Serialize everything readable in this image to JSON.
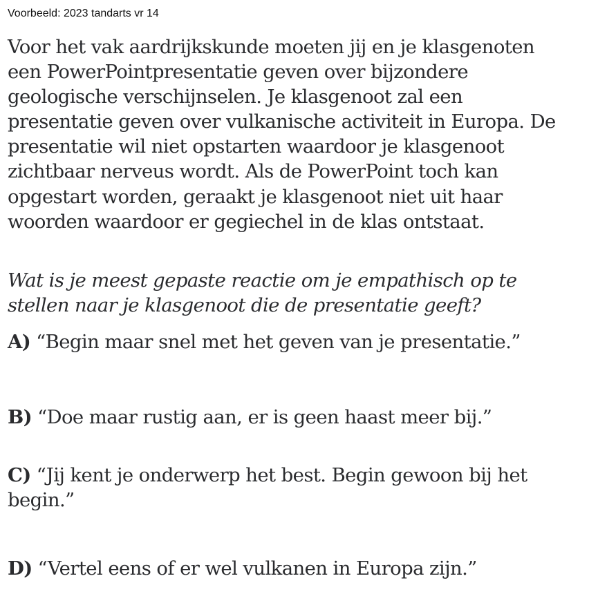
{
  "header": "Voorbeeld: 2023 tandarts vr 14",
  "scenario_lines": [
    "Voor het vak aardrijkskunde moeten jij en je klasgenoten",
    "een PowerPointpresentatie geven over bijzondere",
    "geologische verschijnselen. Je klasgenoot zal een",
    "presentatie geven over vulkanische activiteit in Europa. De",
    "presentatie wil niet opstarten waardoor je klasgenoot",
    "zichtbaar nerveus wordt. Als de PowerPoint toch kan",
    "opgestart worden, geraakt je klasgenoot niet uit haar",
    "woorden waardoor er gegiechel in de klas ontstaat."
  ],
  "question_lines": [
    "Wat is je meest gepaste reactie om je empathisch op te",
    "stellen naar je klasgenoot die de presentatie geeft?"
  ],
  "options": [
    {
      "letter": "A)",
      "lines": [
        "“Begin maar snel met het geven van je presentatie.”"
      ]
    },
    {
      "letter": "B)",
      "lines": [
        "“Doe maar rustig aan, er is geen haast meer bij.”"
      ]
    },
    {
      "letter": "C)",
      "lines": [
        "“Jij kent je onderwerp het best. Begin gewoon bij het",
        "begin.”"
      ]
    },
    {
      "letter": "D)",
      "lines": [
        "“Vertel eens of er wel vulkanen in Europa zijn.”"
      ]
    }
  ]
}
